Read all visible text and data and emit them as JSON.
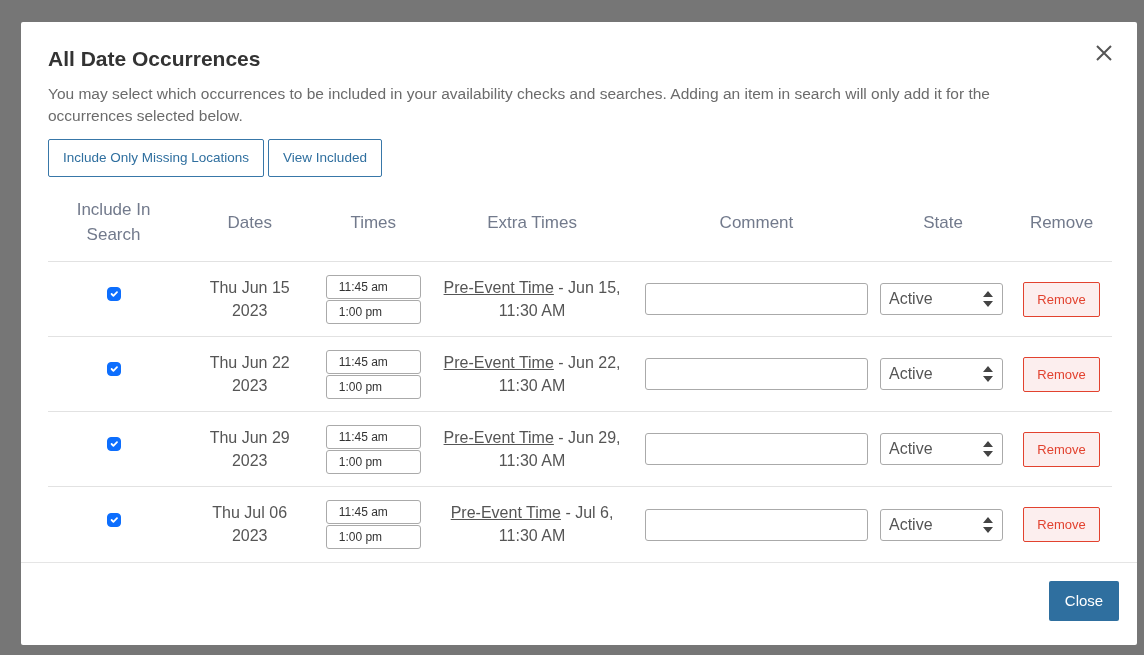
{
  "dialog": {
    "title": "All Date Occurrences",
    "description": "You may select which occurrences to be included in your availability checks and searches. Adding an item in search will only add it for the occurrences selected below."
  },
  "actions": [
    "Include Only Missing Locations",
    "View Included"
  ],
  "table": {
    "columns": [
      "Include In Search",
      "Dates",
      "Times",
      "Extra Times",
      "Comment",
      "State",
      "Remove"
    ],
    "rows": [
      {
        "included": true,
        "date": "Thu Jun 15 2023",
        "start_time": "11:45 am",
        "end_time": "1:00 pm",
        "extra_link": "Pre-Event Time",
        "extra_text": " - Jun 15, 11:30 AM",
        "state": "Active",
        "remove": "Remove"
      },
      {
        "included": true,
        "date": "Thu Jun 22 2023",
        "start_time": "11:45 am",
        "end_time": "1:00 pm",
        "extra_link": "Pre-Event Time",
        "extra_text": " - Jun 22, 11:30 AM",
        "state": "Active",
        "remove": "Remove"
      },
      {
        "included": true,
        "date": "Thu Jun 29 2023",
        "start_time": "11:45 am",
        "end_time": "1:00 pm",
        "extra_link": "Pre-Event Time",
        "extra_text": " - Jun 29, 11:30 AM",
        "state": "Active",
        "remove": "Remove"
      },
      {
        "included": true,
        "date": "Thu Jul 06 2023",
        "start_time": "11:45 am",
        "end_time": "1:00 pm",
        "extra_link": "Pre-Event Time",
        "extra_text": " - Jul 6, 11:30 AM",
        "state": "Active",
        "remove": "Remove"
      }
    ]
  },
  "footer": {
    "close": "Close"
  }
}
